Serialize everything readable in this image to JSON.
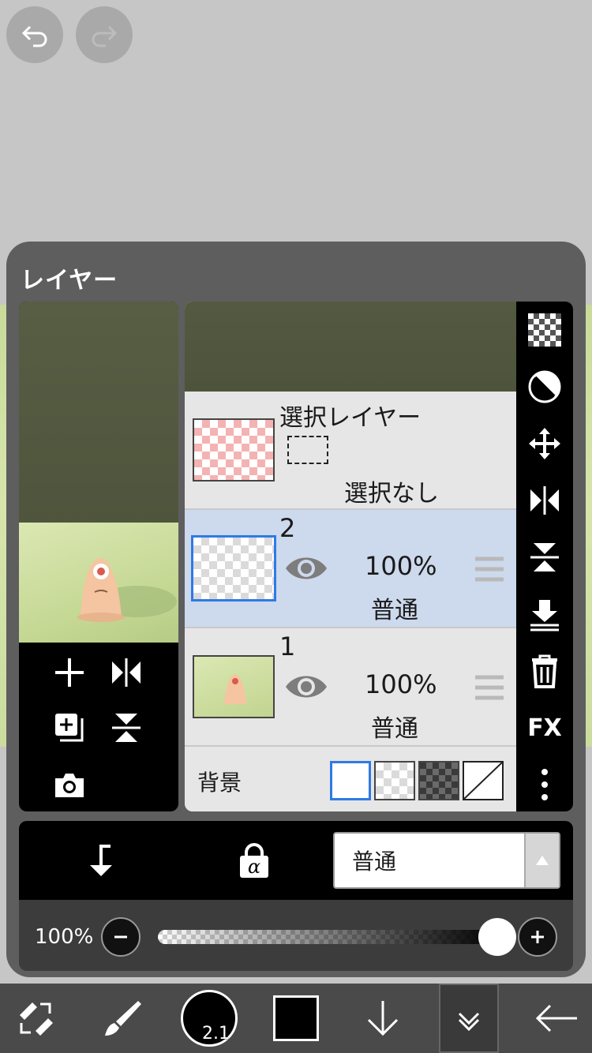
{
  "top_buttons": [
    {
      "name": "undo-icon"
    },
    {
      "name": "redo-icon"
    }
  ],
  "panel": {
    "title": "レイヤー"
  },
  "preview_tools": [
    {
      "name": "add-layer-icon"
    },
    {
      "name": "flip-horizontal-icon"
    },
    {
      "name": "duplicate-layer-icon"
    },
    {
      "name": "flip-vertical-icon"
    },
    {
      "name": "camera-icon"
    }
  ],
  "selection_layer": {
    "title": "選択レイヤー",
    "status": "選択なし"
  },
  "layers": [
    {
      "number": "2",
      "opacity": "100%",
      "blend": "普通",
      "visible": true,
      "selected": true
    },
    {
      "number": "1",
      "opacity": "100%",
      "blend": "普通",
      "visible": true,
      "selected": false
    }
  ],
  "background": {
    "label": "背景",
    "options": [
      "white",
      "transparent",
      "dark-checker",
      "none"
    ],
    "selected": "white"
  },
  "right_toolbar": [
    {
      "name": "transparency-checker-icon"
    },
    {
      "name": "invert-icon"
    },
    {
      "name": "move-icon"
    },
    {
      "name": "flip-horizontal-icon"
    },
    {
      "name": "flip-vertical-icon"
    },
    {
      "name": "merge-down-icon"
    },
    {
      "name": "trash-icon"
    },
    {
      "name": "fx-icon",
      "label": "FX"
    },
    {
      "name": "more-vertical-icon"
    }
  ],
  "blend_bar": {
    "clip_icon": "clipping-icon",
    "alpha_lock_icon": "alpha-lock-icon",
    "alpha_symbol": "α",
    "blend_mode": "普通"
  },
  "opacity": {
    "label": "100%",
    "value": 1.0
  },
  "bottom_toolbar": {
    "brush_size": "2.1",
    "color": "#000000",
    "items": [
      "tool-switch-icon",
      "brush-icon",
      "brush-size-indicator",
      "color-swatch",
      "arrow-down-icon",
      "layer-panel-toggle-icon",
      "back-arrow-icon"
    ]
  }
}
